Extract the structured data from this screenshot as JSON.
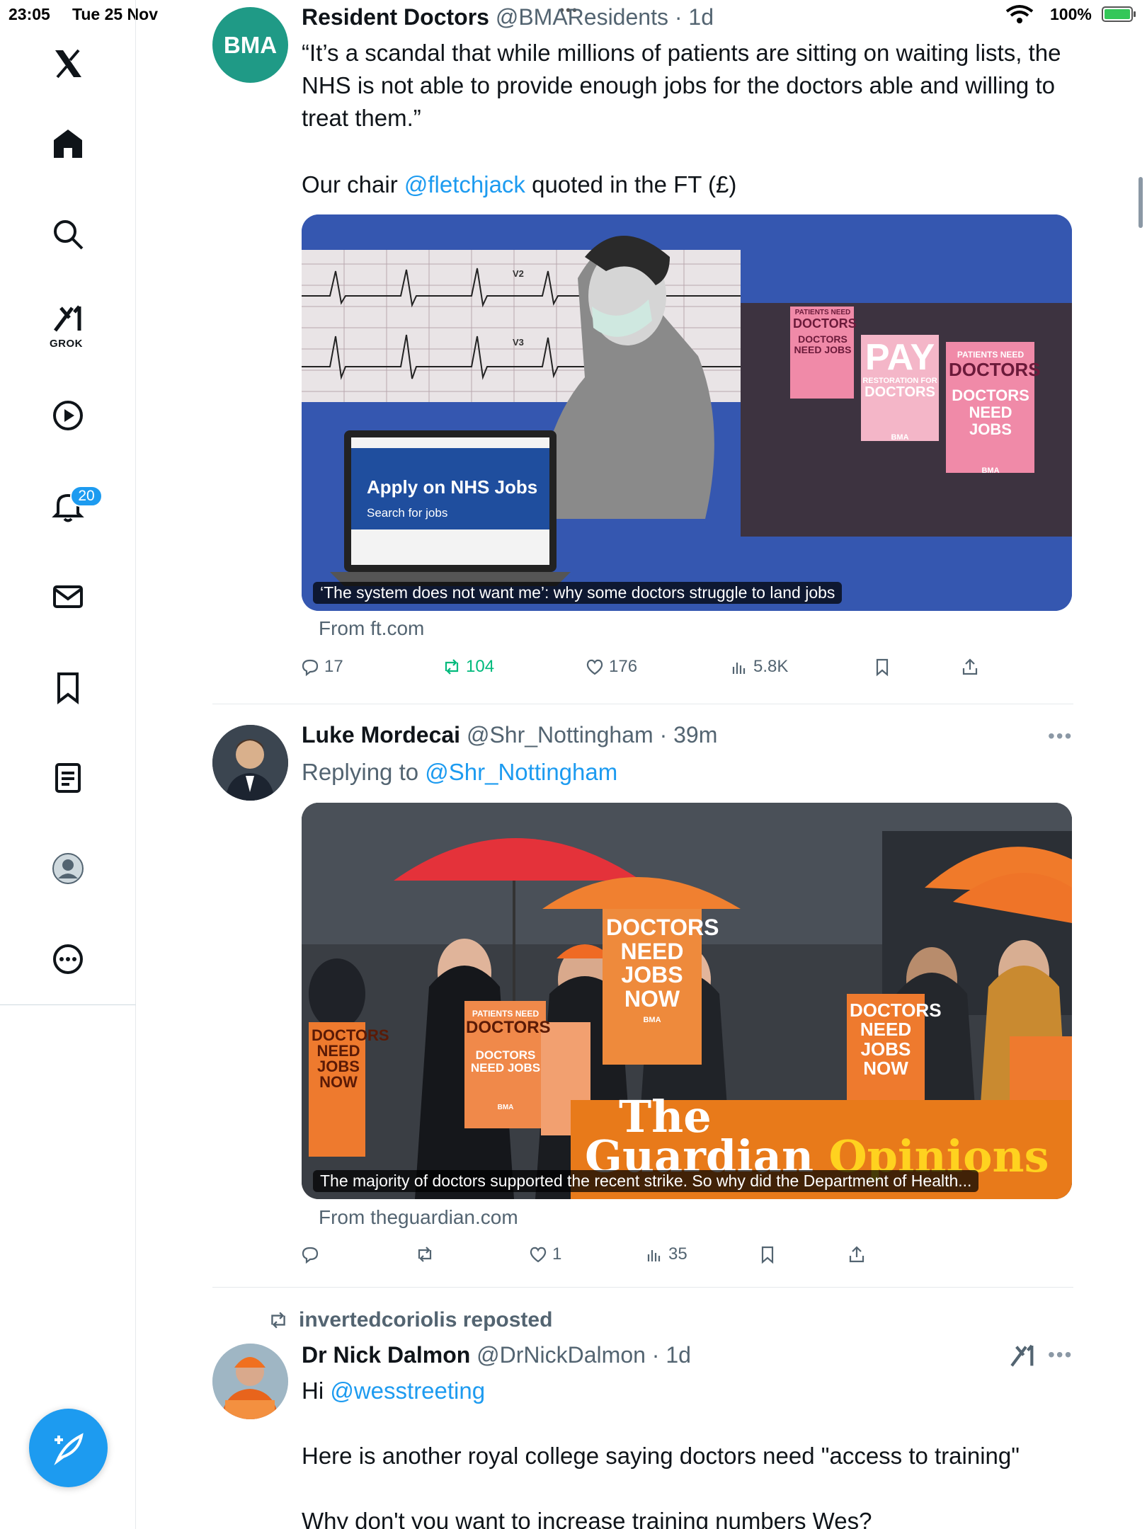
{
  "status_bar": {
    "time": "23:05",
    "date": "Tue 25 Nov",
    "battery": "100%"
  },
  "nav": {
    "grok_label": "GROK",
    "notifications_badge": "20"
  },
  "tweets": [
    {
      "name": "Resident Doctors",
      "handle": "@BMAResidents",
      "time": "1d",
      "text_1": "“It’s a scandal that while millions of patients are sitting on waiting lists, the NHS is not able to provide enough jobs for the doctors able and willing to treat them.”",
      "text_2_prefix": "Our chair ",
      "text_2_mention": "@fletchjack",
      "text_2_suffix": " quoted in the FT (£)",
      "avatar_text": "BMA",
      "card": {
        "caption": "‘The system does not want me’: why some doctors struggle to land jobs",
        "laptop_title": "Apply on NHS Jobs",
        "laptop_sub": "Search for jobs",
        "ecg_v2": "V2",
        "ecg_v3": "V3",
        "sign_1_top": "PATIENTS NEED",
        "sign_1_main": "DOCTORS",
        "sign_1_sub": "DOCTORS NEED JOBS",
        "sign_2_main": "PAY",
        "sign_2_sub": "RESTORATION FOR",
        "sign_2_bottom": "DOCTORS",
        "sign_3_top": "PATIENTS NEED",
        "sign_3_main": "DOCTORS",
        "sign_3_sub": "DOCTORS NEED JOBS",
        "sign_bma": "BMA"
      },
      "from": "From ft.com",
      "replies": "17",
      "reposts": "104",
      "likes": "176",
      "views": "5.8K"
    },
    {
      "name": "Luke Mordecai",
      "handle": "@Shr_Nottingham",
      "time": "39m",
      "replying_prefix": "Replying to ",
      "replying_to": "@Shr_Nottingham",
      "card": {
        "caption": "The majority of doctors supported the recent strike. So why did the Department of Health...",
        "sign_a": "DOCTORS NEED JOBS NOW",
        "sign_b_top": "PATIENTS NEED",
        "sign_b_main": "DOCTORS",
        "sign_b_sub": "DOCTORS NEED JOBS",
        "sign_c": "DOCTORS NEED JOBS NOW",
        "sign_d": "DOCTORS NEED JOBS NOW",
        "brand_1": "The",
        "brand_2": "Guardian",
        "brand_3": "Opinions",
        "sign_bma": "BMA"
      },
      "from": "From theguardian.com",
      "replies": "",
      "reposts": "",
      "likes": "1",
      "views": "35"
    },
    {
      "repost_label": "invertedcoriolis reposted",
      "name": "Dr Nick Dalmon",
      "handle": "@DrNickDalmon",
      "time": "1d",
      "text_1_prefix": "Hi ",
      "text_1_mention": "@wesstreeting",
      "text_2": "Here is another royal college saying doctors need \"access to training\"",
      "text_3": "Why don't you want to increase training numbers Wes?"
    }
  ]
}
